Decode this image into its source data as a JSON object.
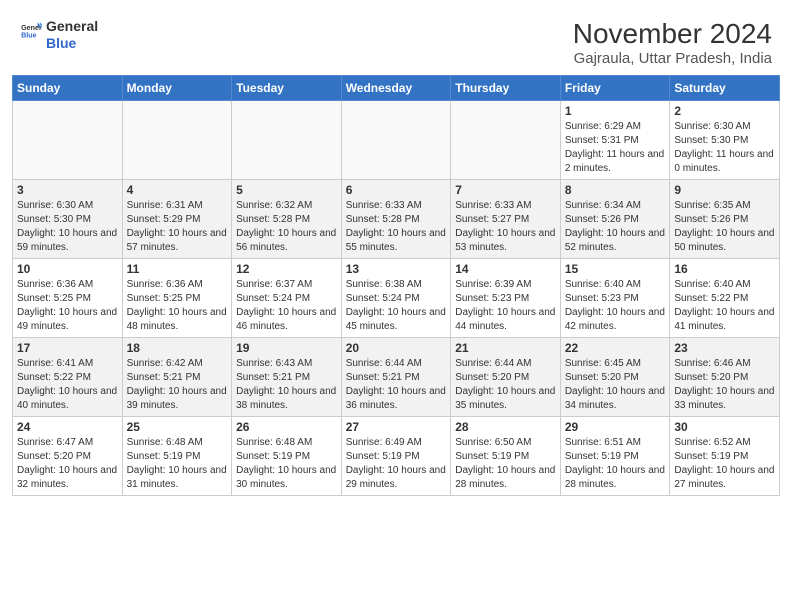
{
  "logo": {
    "general": "General",
    "blue": "Blue"
  },
  "title": "November 2024",
  "location": "Gajraula, Uttar Pradesh, India",
  "days_of_week": [
    "Sunday",
    "Monday",
    "Tuesday",
    "Wednesday",
    "Thursday",
    "Friday",
    "Saturday"
  ],
  "weeks": [
    [
      {
        "day": "",
        "info": ""
      },
      {
        "day": "",
        "info": ""
      },
      {
        "day": "",
        "info": ""
      },
      {
        "day": "",
        "info": ""
      },
      {
        "day": "",
        "info": ""
      },
      {
        "day": "1",
        "info": "Sunrise: 6:29 AM\nSunset: 5:31 PM\nDaylight: 11 hours and 2 minutes."
      },
      {
        "day": "2",
        "info": "Sunrise: 6:30 AM\nSunset: 5:30 PM\nDaylight: 11 hours and 0 minutes."
      }
    ],
    [
      {
        "day": "3",
        "info": "Sunrise: 6:30 AM\nSunset: 5:30 PM\nDaylight: 10 hours and 59 minutes."
      },
      {
        "day": "4",
        "info": "Sunrise: 6:31 AM\nSunset: 5:29 PM\nDaylight: 10 hours and 57 minutes."
      },
      {
        "day": "5",
        "info": "Sunrise: 6:32 AM\nSunset: 5:28 PM\nDaylight: 10 hours and 56 minutes."
      },
      {
        "day": "6",
        "info": "Sunrise: 6:33 AM\nSunset: 5:28 PM\nDaylight: 10 hours and 55 minutes."
      },
      {
        "day": "7",
        "info": "Sunrise: 6:33 AM\nSunset: 5:27 PM\nDaylight: 10 hours and 53 minutes."
      },
      {
        "day": "8",
        "info": "Sunrise: 6:34 AM\nSunset: 5:26 PM\nDaylight: 10 hours and 52 minutes."
      },
      {
        "day": "9",
        "info": "Sunrise: 6:35 AM\nSunset: 5:26 PM\nDaylight: 10 hours and 50 minutes."
      }
    ],
    [
      {
        "day": "10",
        "info": "Sunrise: 6:36 AM\nSunset: 5:25 PM\nDaylight: 10 hours and 49 minutes."
      },
      {
        "day": "11",
        "info": "Sunrise: 6:36 AM\nSunset: 5:25 PM\nDaylight: 10 hours and 48 minutes."
      },
      {
        "day": "12",
        "info": "Sunrise: 6:37 AM\nSunset: 5:24 PM\nDaylight: 10 hours and 46 minutes."
      },
      {
        "day": "13",
        "info": "Sunrise: 6:38 AM\nSunset: 5:24 PM\nDaylight: 10 hours and 45 minutes."
      },
      {
        "day": "14",
        "info": "Sunrise: 6:39 AM\nSunset: 5:23 PM\nDaylight: 10 hours and 44 minutes."
      },
      {
        "day": "15",
        "info": "Sunrise: 6:40 AM\nSunset: 5:23 PM\nDaylight: 10 hours and 42 minutes."
      },
      {
        "day": "16",
        "info": "Sunrise: 6:40 AM\nSunset: 5:22 PM\nDaylight: 10 hours and 41 minutes."
      }
    ],
    [
      {
        "day": "17",
        "info": "Sunrise: 6:41 AM\nSunset: 5:22 PM\nDaylight: 10 hours and 40 minutes."
      },
      {
        "day": "18",
        "info": "Sunrise: 6:42 AM\nSunset: 5:21 PM\nDaylight: 10 hours and 39 minutes."
      },
      {
        "day": "19",
        "info": "Sunrise: 6:43 AM\nSunset: 5:21 PM\nDaylight: 10 hours and 38 minutes."
      },
      {
        "day": "20",
        "info": "Sunrise: 6:44 AM\nSunset: 5:21 PM\nDaylight: 10 hours and 36 minutes."
      },
      {
        "day": "21",
        "info": "Sunrise: 6:44 AM\nSunset: 5:20 PM\nDaylight: 10 hours and 35 minutes."
      },
      {
        "day": "22",
        "info": "Sunrise: 6:45 AM\nSunset: 5:20 PM\nDaylight: 10 hours and 34 minutes."
      },
      {
        "day": "23",
        "info": "Sunrise: 6:46 AM\nSunset: 5:20 PM\nDaylight: 10 hours and 33 minutes."
      }
    ],
    [
      {
        "day": "24",
        "info": "Sunrise: 6:47 AM\nSunset: 5:20 PM\nDaylight: 10 hours and 32 minutes."
      },
      {
        "day": "25",
        "info": "Sunrise: 6:48 AM\nSunset: 5:19 PM\nDaylight: 10 hours and 31 minutes."
      },
      {
        "day": "26",
        "info": "Sunrise: 6:48 AM\nSunset: 5:19 PM\nDaylight: 10 hours and 30 minutes."
      },
      {
        "day": "27",
        "info": "Sunrise: 6:49 AM\nSunset: 5:19 PM\nDaylight: 10 hours and 29 minutes."
      },
      {
        "day": "28",
        "info": "Sunrise: 6:50 AM\nSunset: 5:19 PM\nDaylight: 10 hours and 28 minutes."
      },
      {
        "day": "29",
        "info": "Sunrise: 6:51 AM\nSunset: 5:19 PM\nDaylight: 10 hours and 28 minutes."
      },
      {
        "day": "30",
        "info": "Sunrise: 6:52 AM\nSunset: 5:19 PM\nDaylight: 10 hours and 27 minutes."
      }
    ]
  ]
}
